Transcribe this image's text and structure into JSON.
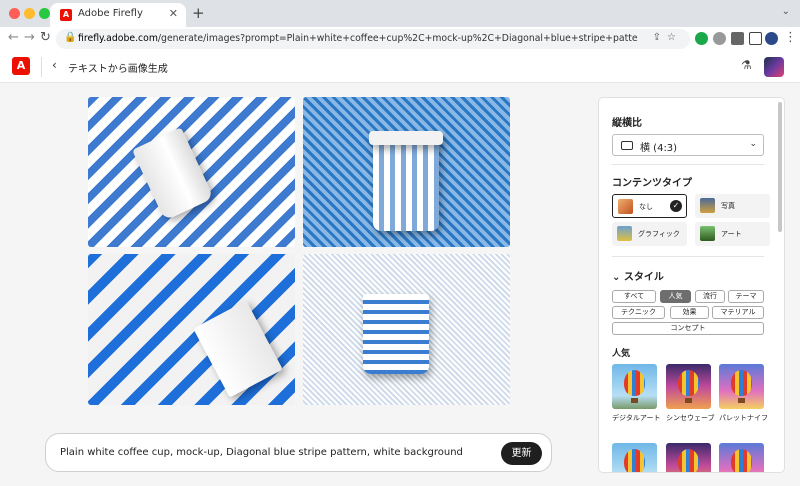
{
  "browser": {
    "tab_title": "Adobe Firefly",
    "url_host": "firefly.adobe.com",
    "url_path": "/generate/images?prompt=Plain+white+coffee+cup%2C+mock-up%2C+Diagonal+blue+stripe+pattern%2C+white+background&seed=1..."
  },
  "header": {
    "breadcrumb": "テキストから画像生成"
  },
  "prompt": {
    "text": "Plain white coffee cup, mock-up, Diagonal blue stripe pattern, white background",
    "generate_label": "更新"
  },
  "panel": {
    "aspect_heading": "縦横比",
    "aspect_value": "横 (4:3)",
    "content_type_heading": "コンテンツタイプ",
    "content_types": [
      {
        "label": "なし",
        "selected": true
      },
      {
        "label": "写真",
        "selected": false
      },
      {
        "label": "グラフィック",
        "selected": false
      },
      {
        "label": "アート",
        "selected": false
      }
    ],
    "style_heading": "スタイル",
    "style_chips": [
      {
        "label": "すべて",
        "active": false
      },
      {
        "label": "人気",
        "active": true
      },
      {
        "label": "流行",
        "active": false
      },
      {
        "label": "テーマ",
        "active": false
      },
      {
        "label": "テクニック",
        "active": false
      },
      {
        "label": "効果",
        "active": false
      },
      {
        "label": "マテリアル",
        "active": false
      },
      {
        "label": "コンセプト",
        "active": false
      }
    ],
    "popular_heading": "人気",
    "popular_styles": [
      {
        "label": "デジタルアート"
      },
      {
        "label": "シンセウェーブ"
      },
      {
        "label": "パレットナイフ"
      }
    ]
  },
  "colors": {
    "adobe_red": "#eb1000",
    "button_dark": "#1f1f1f",
    "stripe_blue": "#2a78c4"
  }
}
